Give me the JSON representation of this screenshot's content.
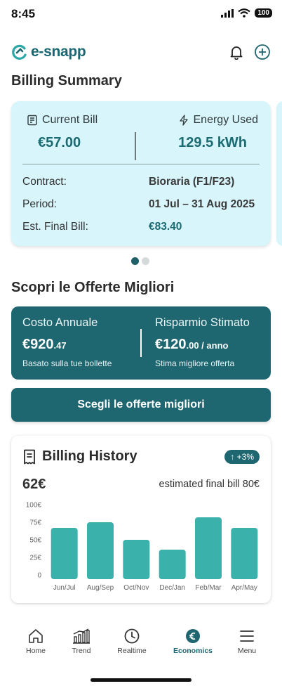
{
  "status_bar": {
    "time": "8:45",
    "battery": "100"
  },
  "app": {
    "logo_text": "e-snapp"
  },
  "billing_summary": {
    "title": "Billing Summary",
    "current_bill_label": "Current Bill",
    "current_bill_value": "€57.00",
    "energy_used_label": "Energy Used",
    "energy_used_value": "129.5 kWh",
    "rows": [
      {
        "label": "Contract:",
        "value": "Bioraria (F1/F23)"
      },
      {
        "label": "Period:",
        "value": "01 Jul – 31 Aug 2025"
      },
      {
        "label": "Est. Final Bill:",
        "value": "€83.40"
      }
    ],
    "pager": {
      "pages": 2,
      "active": 0
    }
  },
  "offers": {
    "title": "Scopri le Offerte Migliori",
    "annual_cost_label": "Costo Annuale",
    "annual_cost_main": "€920",
    "annual_cost_cents": ".47",
    "annual_cost_note": "Basato sulla tue bollette",
    "savings_label": "Risparmio Stimato",
    "savings_main": "€120",
    "savings_suffix": ".00 / anno",
    "savings_note": "Stima migliore offerta",
    "cta_label": "Scegli le offerte migliori"
  },
  "billing_history": {
    "title": "Billing History",
    "badge": "↑ +3%",
    "amount": "62€",
    "estimate": "estimated final bill 80€"
  },
  "chart_data": {
    "type": "bar",
    "categories": [
      "Jun/Jul",
      "Aug/Sep",
      "Oct/Nov",
      "Dec/Jan",
      "Feb/Mar",
      "Apr/May"
    ],
    "values": [
      67,
      75,
      50,
      36,
      82,
      67
    ],
    "ylim": [
      0,
      100
    ],
    "yticks": [
      "0",
      "25€",
      "50€",
      "75€",
      "100€"
    ],
    "ytick_values": [
      0,
      25,
      50,
      75,
      100
    ],
    "grid": false,
    "bar_color": "#3bb1ac"
  },
  "nav": [
    {
      "label": "Home",
      "icon": "home-icon"
    },
    {
      "label": "Trend",
      "icon": "bar-chart-icon"
    },
    {
      "label": "Realtime",
      "icon": "clock-icon"
    },
    {
      "label": "Economics",
      "icon": "euro-icon",
      "active": true
    },
    {
      "label": "Menu",
      "icon": "menu-icon"
    }
  ],
  "colors": {
    "primary": "#1e6670",
    "summary_bg": "#d7f5fb",
    "bar": "#3bb1ac"
  }
}
